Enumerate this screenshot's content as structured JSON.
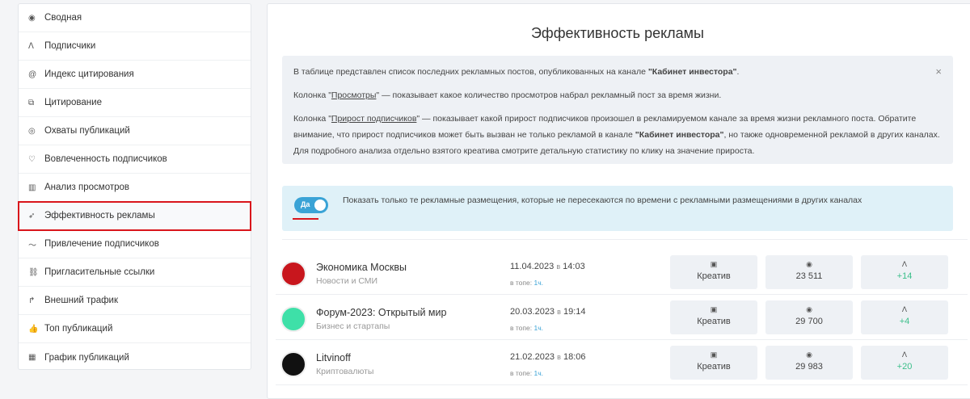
{
  "sidebar": {
    "items": [
      {
        "label": "Сводная",
        "icon": "dashboard-icon",
        "glyph": "◉"
      },
      {
        "label": "Подписчики",
        "icon": "users-icon",
        "glyph": "ꓥ"
      },
      {
        "label": "Индекс цитирования",
        "icon": "at-icon",
        "glyph": "@"
      },
      {
        "label": "Цитирование",
        "icon": "quote-icon",
        "glyph": "⧉"
      },
      {
        "label": "Охваты публикаций",
        "icon": "eye-icon",
        "glyph": "◎"
      },
      {
        "label": "Вовлеченность подписчиков",
        "icon": "heart-icon",
        "glyph": "♡"
      },
      {
        "label": "Анализ просмотров",
        "icon": "bar-chart-icon",
        "glyph": "▥"
      },
      {
        "label": "Эффективность рекламы",
        "icon": "rocket-icon",
        "glyph": "➶"
      },
      {
        "label": "Привлечение подписчиков",
        "icon": "trend-icon",
        "glyph": "〜"
      },
      {
        "label": "Пригласительные ссылки",
        "icon": "link-icon",
        "glyph": "⛓"
      },
      {
        "label": "Внешний трафик",
        "icon": "arrow-forward-icon",
        "glyph": "↱"
      },
      {
        "label": "Топ публикаций",
        "icon": "thumbs-up-icon",
        "glyph": "👍"
      },
      {
        "label": "График публикаций",
        "icon": "calendar-icon",
        "glyph": "▦"
      }
    ]
  },
  "main": {
    "title": "Эффективность рекламы",
    "info": {
      "l1a": "В таблице представлен список последних рекламных постов, опубликованных на канале ",
      "l1b": "\"Кабинет инвестора\"",
      ".": ".",
      "l2a": "Колонка \"",
      "l2link": "Просмотры",
      "l2b": "\" — показывает какое количество просмотров набрал рекламный пост за время жизни.",
      "l3a": "Колонка \"",
      "l3link": "Прирост подписчиков",
      "l3b": "\" — показывает какой прирост подписчиков произошел в рекламируемом канале за время жизни рекламного поста. Обратите внимание, что прирост подписчиков может быть вызван не только рекламой в канале ",
      "l3c": "\"Кабинет инвестора\"",
      "l3d": ", но также одновременной рекламой в других каналах. Для подробного анализа отдельно взятого креатива смотрите детальную статистику по клику на значение прироста.",
      "close": "×"
    },
    "toggle": {
      "label": "Да",
      "text": "Показать только те рекламные размещения, которые не пересекаются по времени с рекламными размещениями в других каналах"
    },
    "rows": [
      {
        "name": "Экономика Москвы",
        "category": "Новости и СМИ",
        "date": "11.04.2023",
        "sep": "в",
        "time": "14:03",
        "top_label": "в топе:",
        "top_value": "1ч.",
        "creative": "Креатив",
        "views": "23 511",
        "subs": "+14",
        "avatar_color": "#c8161d"
      },
      {
        "name": "Форум-2023: Открытый мир",
        "category": "Бизнес и стартапы",
        "date": "20.03.2023",
        "sep": "в",
        "time": "19:14",
        "top_label": "в топе:",
        "top_value": "1ч.",
        "creative": "Креатив",
        "views": "29 700",
        "subs": "+4",
        "avatar_color": "#3ee0a8"
      },
      {
        "name": "Litvinoff",
        "category": "Криптовалюты",
        "date": "21.02.2023",
        "sep": "в",
        "time": "18:06",
        "top_label": "в топе:",
        "top_value": "1ч.",
        "creative": "Креатив",
        "views": "29 983",
        "subs": "+20",
        "avatar_color": "#111111"
      }
    ]
  }
}
